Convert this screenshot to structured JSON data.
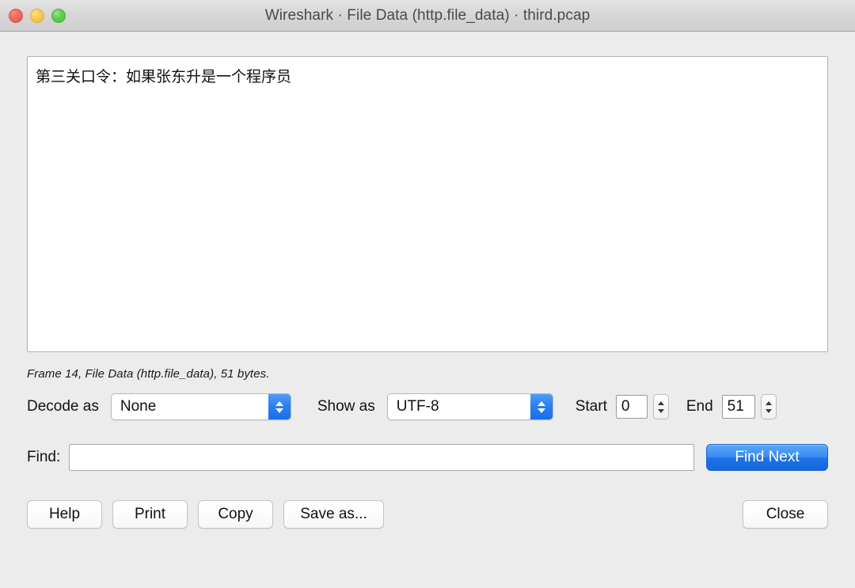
{
  "window": {
    "title": "Wireshark · File Data (http.file_data) · third.pcap",
    "traffic_lights": {
      "close_label": "close",
      "minimize_label": "minimize",
      "maximize_label": "maximize"
    }
  },
  "data_view": {
    "content": "第三关口令：如果张东升是一个程序员"
  },
  "status": {
    "text": "Frame 14, File Data (http.file_data), 51 bytes."
  },
  "controls": {
    "decode_as_label": "Decode as",
    "decode_as_value": "None",
    "show_as_label": "Show as",
    "show_as_value": "UTF-8",
    "start_label": "Start",
    "start_value": "0",
    "end_label": "End",
    "end_value": "51"
  },
  "find": {
    "label": "Find:",
    "value": "",
    "placeholder": "",
    "button_label": "Find Next"
  },
  "buttons": {
    "help": "Help",
    "print": "Print",
    "copy": "Copy",
    "save_as": "Save as...",
    "close": "Close"
  },
  "colors": {
    "accent_blue": "#1c72e8",
    "window_bg": "#ececec",
    "titlebar_bg": "#d6d6d6",
    "field_bg": "#ffffff",
    "traffic_red": "#f2685c",
    "traffic_yellow": "#f8ca52",
    "traffic_green": "#62ca52"
  }
}
